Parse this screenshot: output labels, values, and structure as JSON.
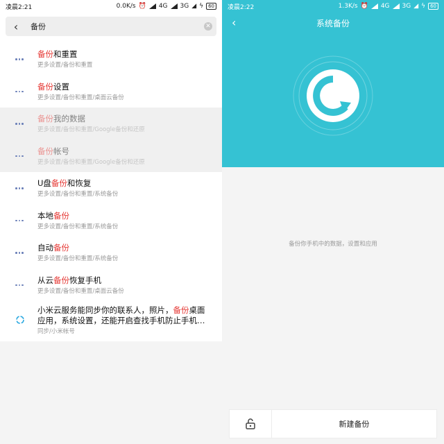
{
  "left": {
    "status": {
      "time": "凌晨2:21",
      "speed": "0.0K/s",
      "net_a": "4G",
      "net_b": "3G",
      "battery": "60"
    },
    "search": {
      "value": "备份"
    },
    "results": [
      {
        "pre": "",
        "hl": "备份",
        "post": "和重置",
        "path": "更多设置/备份和重置",
        "dim": false
      },
      {
        "pre": "",
        "hl": "备份",
        "post": "设置",
        "path": "更多设置/备份和重置/桌面云备份",
        "dim": false
      },
      {
        "pre": "",
        "hl": "备份",
        "post": "我的数据",
        "path": "更多设置/备份和重置/Google备份和还原",
        "dim": true
      },
      {
        "pre": "",
        "hl": "备份",
        "post": "帐号",
        "path": "更多设置/备份和重置/Google备份和还原",
        "dim": true
      },
      {
        "pre": "U盘",
        "hl": "备份",
        "post": "和恢复",
        "path": "更多设置/备份和重置/系统备份",
        "dim": false
      },
      {
        "pre": "本地",
        "hl": "备份",
        "post": "",
        "path": "更多设置/备份和重置/系统备份",
        "dim": false
      },
      {
        "pre": "自动",
        "hl": "备份",
        "post": "",
        "path": "更多设置/备份和重置/系统备份",
        "dim": false
      },
      {
        "pre": "从云",
        "hl": "备份",
        "post": "恢复手机",
        "path": "更多设置/备份和重置/桌面云备份",
        "dim": false
      }
    ],
    "cloud_result": {
      "line1_pre": "小米云服务能同步你的联系人，照片，",
      "line1_hl": "备份",
      "line1_post": "桌面",
      "line2": "应用，系统设置，还能开启查找手机防止手机…",
      "path": "同步/小米帐号"
    }
  },
  "right": {
    "status": {
      "time": "凌晨2:22",
      "speed": "1.3K/s",
      "net_a": "4G",
      "net_b": "3G",
      "battery": "60"
    },
    "title": "系统备份",
    "description": "备份你手机中的数据，设置和应用",
    "new_backup_label": "新建备份",
    "accent": "#35c2d3"
  }
}
